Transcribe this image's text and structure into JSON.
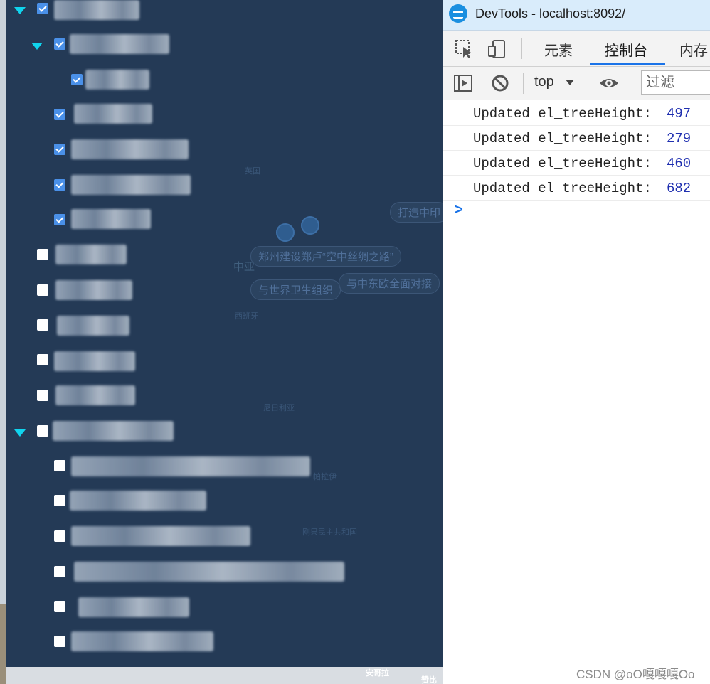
{
  "map": {
    "pills": [
      "郑州建设郑卢“空中丝绸之路”",
      "与世界卫生组织",
      "与中东欧全面对接",
      "打造中印"
    ],
    "place_labels": [
      "中亚",
      "西班牙",
      "安哥拉",
      "刚果民主共和国",
      "尼日利亚",
      "帕拉伊",
      "英国"
    ],
    "bottom_labels": [
      "安哥拉",
      "赞比"
    ]
  },
  "tree": {
    "nodes": [
      {
        "checked": true,
        "expanded": true
      },
      {
        "checked": true,
        "expanded": true
      },
      {
        "checked": true
      },
      {
        "checked": true
      },
      {
        "checked": true
      },
      {
        "checked": true
      },
      {
        "checked": true
      },
      {
        "checked": false
      },
      {
        "checked": false
      },
      {
        "checked": false
      },
      {
        "checked": false
      },
      {
        "checked": false
      },
      {
        "checked": false,
        "expanded": true
      },
      {
        "checked": false
      },
      {
        "checked": false
      },
      {
        "checked": false
      },
      {
        "checked": false
      },
      {
        "checked": false
      },
      {
        "checked": false
      }
    ]
  },
  "devtools": {
    "window_title": "DevTools - localhost:8092/",
    "tabs": [
      {
        "label": "元素",
        "active": false
      },
      {
        "label": "控制台",
        "active": true
      },
      {
        "label": "内存",
        "active": false
      }
    ],
    "toolbar": {
      "context": "top",
      "filter_placeholder": "过滤"
    },
    "console": {
      "logs": [
        {
          "text": "Updated el_treeHeight:",
          "value": "497"
        },
        {
          "text": "Updated el_treeHeight:",
          "value": "279"
        },
        {
          "text": "Updated el_treeHeight:",
          "value": "460"
        },
        {
          "text": "Updated el_treeHeight:",
          "value": "682"
        }
      ],
      "prompt": ">"
    }
  },
  "watermark": "CSDN @oO嘎嘎嘎Oo"
}
